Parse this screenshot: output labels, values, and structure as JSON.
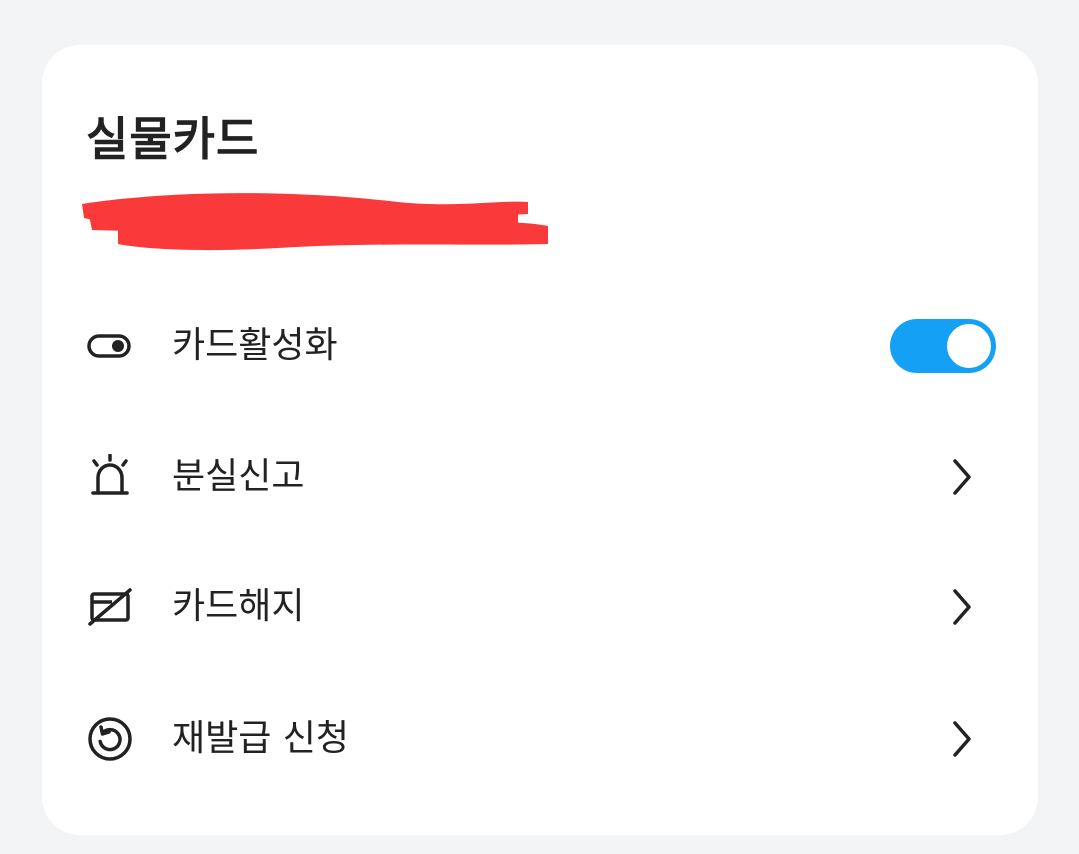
{
  "card": {
    "title": "실물카드"
  },
  "menu": {
    "activate": {
      "label": "카드활성화",
      "icon": "toggle-switch-icon",
      "toggle_on": true
    },
    "report_lost": {
      "label": "분실신고",
      "icon": "siren-icon"
    },
    "cancel_card": {
      "label": "카드해지",
      "icon": "card-cancel-icon"
    },
    "reissue": {
      "label": "재발급 신청",
      "icon": "refresh-circle-icon"
    }
  },
  "colors": {
    "accent": "#14a0f5",
    "redaction": "#fa3a3a",
    "background": "#f3f4f6",
    "card": "#ffffff",
    "text": "#222222"
  }
}
